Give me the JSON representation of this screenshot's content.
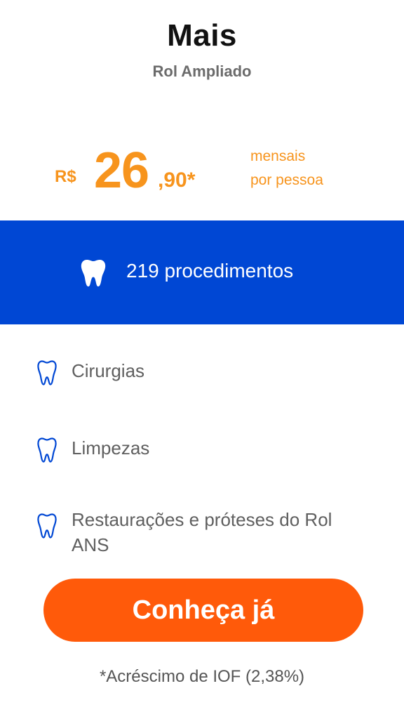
{
  "plan": {
    "name": "Mais",
    "subtitle": "Rol Ampliado"
  },
  "price": {
    "currency": "R$",
    "integer": "26",
    "cents": ",90*",
    "period_line1": "mensais",
    "period_line2": "por pessoa"
  },
  "banner": {
    "icon": "tooth-icon",
    "text": "219 procedimentos"
  },
  "features": [
    {
      "icon": "tooth-icon",
      "label": "Cirurgias"
    },
    {
      "icon": "tooth-icon",
      "label": "Limpezas"
    },
    {
      "icon": "tooth-icon",
      "label": "Restaurações e próteses do Rol ANS"
    }
  ],
  "cta": {
    "label": "Conheça já"
  },
  "footnote": "*Acréscimo de IOF (2,38%)",
  "colors": {
    "accent_orange": "#f7941d",
    "cta_orange": "#ff5a0a",
    "banner_blue": "#0047d4",
    "icon_blue": "#0047d4"
  }
}
